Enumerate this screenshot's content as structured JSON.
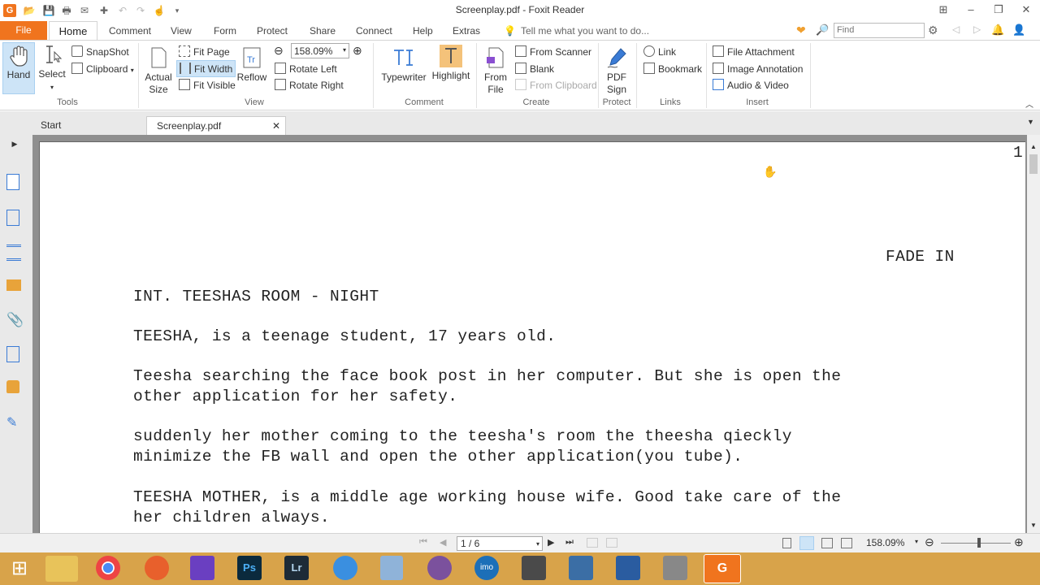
{
  "window": {
    "title": "Screenplay.pdf - Foxit Reader",
    "controls": {
      "minimize": "–",
      "maximize": "❐",
      "close": "✕"
    }
  },
  "menu": {
    "tabs": [
      "File",
      "Home",
      "Comment",
      "View",
      "Form",
      "Protect",
      "Share",
      "Connect",
      "Help",
      "Extras"
    ],
    "tell_me": "Tell me what you want to do...",
    "find_placeholder": "Find"
  },
  "ribbon": {
    "tools": {
      "hand": "Hand",
      "select": "Select",
      "snapshot": "SnapShot",
      "clipboard": "Clipboard",
      "label": "Tools"
    },
    "view": {
      "actual_size_1": "Actual",
      "actual_size_2": "Size",
      "fit_page": "Fit Page",
      "fit_width": "Fit Width",
      "fit_visible": "Fit Visible",
      "reflow": "Reflow",
      "zoom": "158.09%",
      "rotate_left": "Rotate Left",
      "rotate_right": "Rotate Right",
      "label": "View"
    },
    "comment": {
      "typewriter": "Typewriter",
      "highlight": "Highlight",
      "label": "Comment"
    },
    "create": {
      "from_file_1": "From",
      "from_file_2": "File",
      "from_scanner": "From Scanner",
      "blank": "Blank",
      "from_clipboard": "From Clipboard",
      "label": "Create"
    },
    "protect": {
      "pdf_sign_1": "PDF",
      "pdf_sign_2": "Sign",
      "label": "Protect"
    },
    "links": {
      "link": "Link",
      "bookmark": "Bookmark",
      "label": "Links"
    },
    "insert": {
      "file_attachment": "File Attachment",
      "image_annotation": "Image Annotation",
      "audio_video": "Audio & Video",
      "label": "Insert"
    }
  },
  "doc_tabs": {
    "start": "Start",
    "current": "Screenplay.pdf"
  },
  "document": {
    "page_number": "1",
    "lines": [
      "FADE IN",
      "INT. TEESHAS ROOM - NIGHT",
      "TEESHA, is a teenage student, 17 years old.",
      "Teesha searching the face book post in her computer. But she is open the",
      "other application for her safety.",
      "suddenly her mother coming to the teesha's room the theesha qieckly",
      "minimize the FB wall and open the other application(you tube).",
      "TEESHA MOTHER, is a middle age working house wife. Good take care of the",
      "her children always."
    ]
  },
  "status": {
    "page": "1 / 6",
    "zoom": "158.09%"
  },
  "colors": {
    "accent": "#f0741e",
    "taskbar": "#d8a34a",
    "selected": "#cde4f7"
  }
}
